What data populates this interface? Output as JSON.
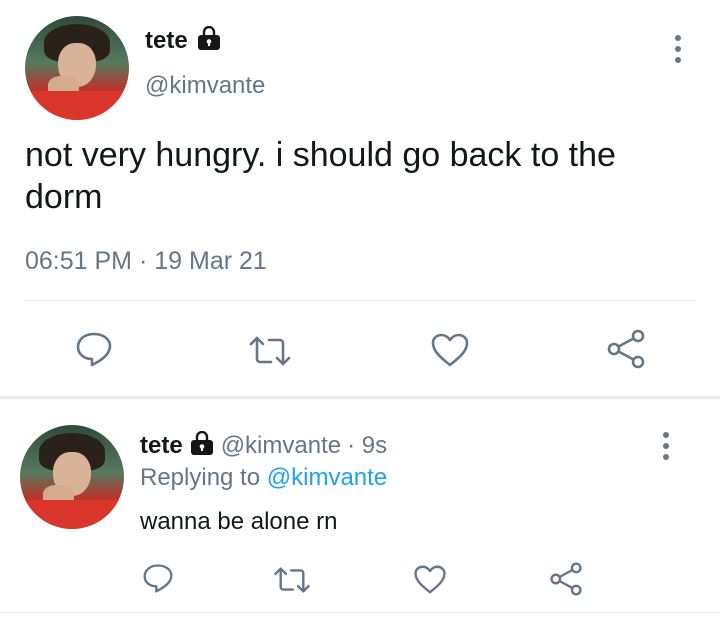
{
  "main_tweet": {
    "display_name": "tete",
    "handle": "@kimvante",
    "text": "not very hungry. i should go back to the dorm",
    "time": "06:51 PM",
    "separator": "·",
    "date": "19 Mar 21"
  },
  "reply": {
    "display_name": "tete",
    "handle": "@kimvante",
    "age": "· 9s",
    "replying_prefix": "Replying to",
    "replying_to": "@kimvante",
    "text": "wanna be alone rn"
  },
  "icons": {
    "lock": "lock-icon",
    "more": "more-vertical-icon",
    "reply": "reply-icon",
    "retweet": "retweet-icon",
    "like": "like-heart-icon",
    "share": "share-icon"
  },
  "colors": {
    "text": "#14171a",
    "secondary": "#657786",
    "link": "#1da1f2",
    "divider": "#e1e8ed"
  }
}
